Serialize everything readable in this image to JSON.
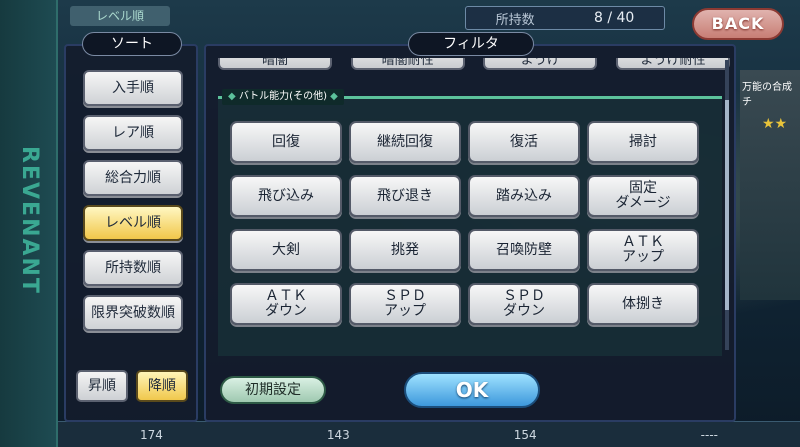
{
  "background": {
    "vertical_logo": "REVENANT",
    "chip": "レベル順",
    "count_label": "所持数",
    "count_value": "8 / 40",
    "back_label": "BACK",
    "card_label": "万能の合成チ",
    "card_stars": "★★",
    "bottom_stats": [
      "174",
      "143",
      "154",
      "----"
    ]
  },
  "sort": {
    "title": "ソート",
    "items": [
      {
        "label": "入手順",
        "active": false
      },
      {
        "label": "レア順",
        "active": false
      },
      {
        "label": "総合力順",
        "active": false
      },
      {
        "label": "レベル順",
        "active": true
      },
      {
        "label": "所持数順",
        "active": false
      },
      {
        "label": "限界突破数順",
        "active": false
      }
    ],
    "asc_label": "昇順",
    "desc_label": "降順",
    "selected_order": "降順"
  },
  "filter": {
    "title": "フィルタ",
    "prev_row": [
      "暗闇",
      "暗闇耐性",
      "ようけ",
      "ようけ耐性"
    ],
    "section_label": "バトル能力(その他)",
    "buttons": [
      "回復",
      "継続回復",
      "復活",
      "掃討",
      "飛び込み",
      "飛び退き",
      "踏み込み",
      "固定\nダメージ",
      "大剣",
      "挑発",
      "召喚防壁",
      "ＡＴＫ\nアップ",
      "ＡＴＫ\nダウン",
      "ＳＰＤ\nアップ",
      "ＳＰＤ\nダウン",
      "体捌き"
    ],
    "reset_label": "初期設定",
    "ok_label": "OK"
  }
}
